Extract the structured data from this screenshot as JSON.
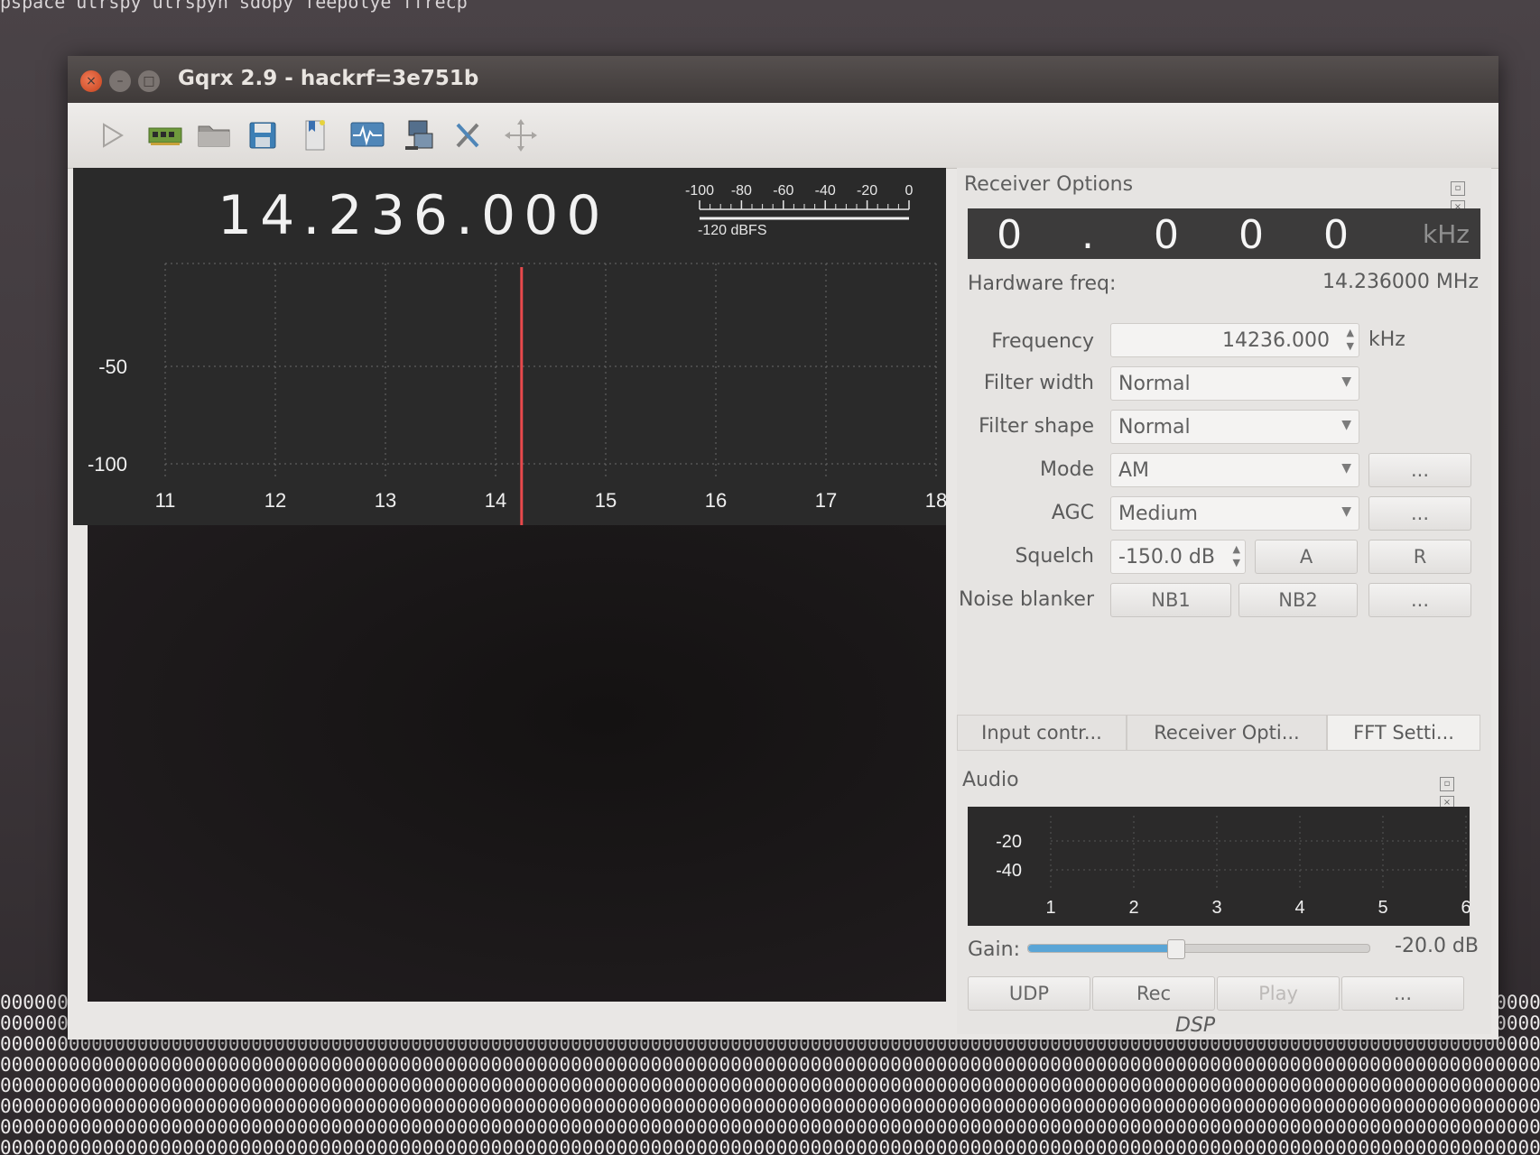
{
  "terminal": {
    "top_line": "pspace  utrspy  utrspyh  sdopy  feepolye  ffrecp"
  },
  "window": {
    "title": "Gqrx 2.9 - hackrf=3e751b",
    "buttons": {
      "close": "×",
      "minimize": "–",
      "maximize": "□"
    }
  },
  "toolbar": {
    "icons": [
      "play-icon",
      "hardware-icon",
      "folder-icon",
      "save-icon",
      "bookmark-icon",
      "waveform-icon",
      "network-icon",
      "tools-icon",
      "move-icon"
    ]
  },
  "plot": {
    "frequency_display": "14.236.000",
    "meter_ticks": [
      "-100",
      "-80",
      "-60",
      "-40",
      "-20",
      "0"
    ],
    "meter_label": "-120 dBFS",
    "y_labels": [
      "-50",
      "-100"
    ],
    "x_labels": [
      "11",
      "12",
      "13",
      "14",
      "15",
      "16",
      "17",
      "18"
    ],
    "marker_color": "#e8494c"
  },
  "receiver": {
    "title": "Receiver Options",
    "lcd_value": "0.000",
    "lcd_unit": "kHz",
    "hardware_label": "Hardware freq:",
    "hardware_value": "14.236000 MHz",
    "frequency_label": "Frequency",
    "frequency_value": "14236.000",
    "frequency_unit": "kHz",
    "filter_width_label": "Filter width",
    "filter_width_value": "Normal",
    "filter_shape_label": "Filter shape",
    "filter_shape_value": "Normal",
    "mode_label": "Mode",
    "mode_value": "AM",
    "agc_label": "AGC",
    "agc_value": "Medium",
    "squelch_label": "Squelch",
    "squelch_value": "-150.0 dB",
    "squelch_a": "A",
    "squelch_r": "R",
    "noise_label": "Noise blanker",
    "nb1": "NB1",
    "nb2": "NB2",
    "more": "..."
  },
  "tabs": [
    "Input contr...",
    "Receiver Opti...",
    "FFT Setti..."
  ],
  "audio": {
    "title": "Audio",
    "y_labels": [
      "-20",
      "-40"
    ],
    "x_labels": [
      "1",
      "2",
      "3",
      "4",
      "5",
      "6"
    ],
    "gain_label": "Gain:",
    "gain_value": "-20.0 dB",
    "gain_fraction": 0.43,
    "udp": "UDP",
    "rec": "Rec",
    "play": "Play",
    "more": "...",
    "dsp": "DSP"
  }
}
